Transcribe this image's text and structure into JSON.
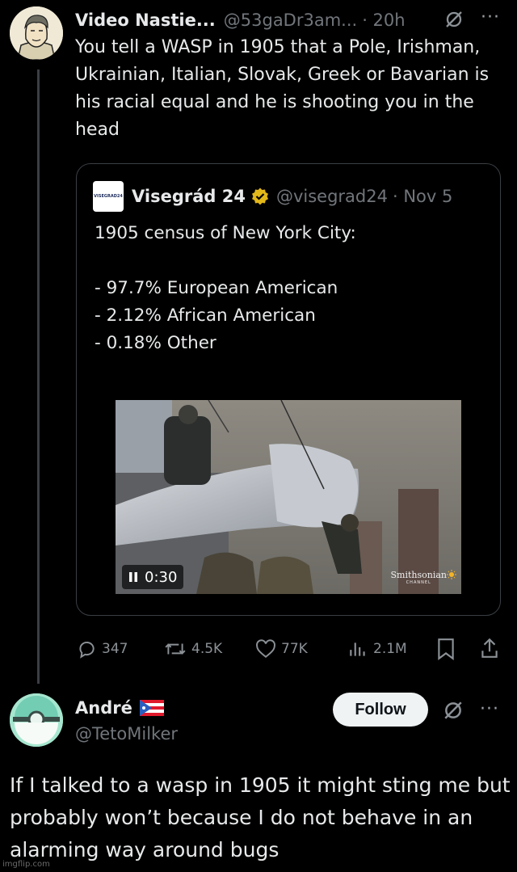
{
  "post": {
    "author_name": "Video Nastie...",
    "handle": "@53gaDr3am...",
    "time": "· 20h",
    "text": "You tell a WASP in 1905 that a Pole, Irishman, Ukrainian, Italian, Slovak, Greek or Bavarian is his racial equal and he is shooting you in the head"
  },
  "quote": {
    "logo_text": "VISEGRAD24",
    "author_name": "Visegrád 24",
    "handle": "@visegrad24",
    "time": "· Nov 5",
    "line1": "1905 census of New York City:",
    "line2": "- 97.7% European American",
    "line3": "- 2.12% African American",
    "line4": "- 0.18% Other",
    "video_duration": "0:30",
    "video_watermark": "Smithsonian",
    "video_watermark_sub": "CHANNEL"
  },
  "actions": {
    "replies": "347",
    "reposts": "4.5K",
    "likes": "77K",
    "views": "2.1M"
  },
  "reply": {
    "author_name": "André",
    "handle": "@TetoMilker",
    "follow_label": "Follow",
    "text": "If I talked to a wasp in 1905 it might sting me but probably won’t because I do not behave in an alarming way around bugs"
  },
  "watermark": "imgflip.com",
  "colors": {
    "background": "#000000",
    "text": "#e7e9ea",
    "muted": "#71767b",
    "verified": "#e2b719"
  }
}
